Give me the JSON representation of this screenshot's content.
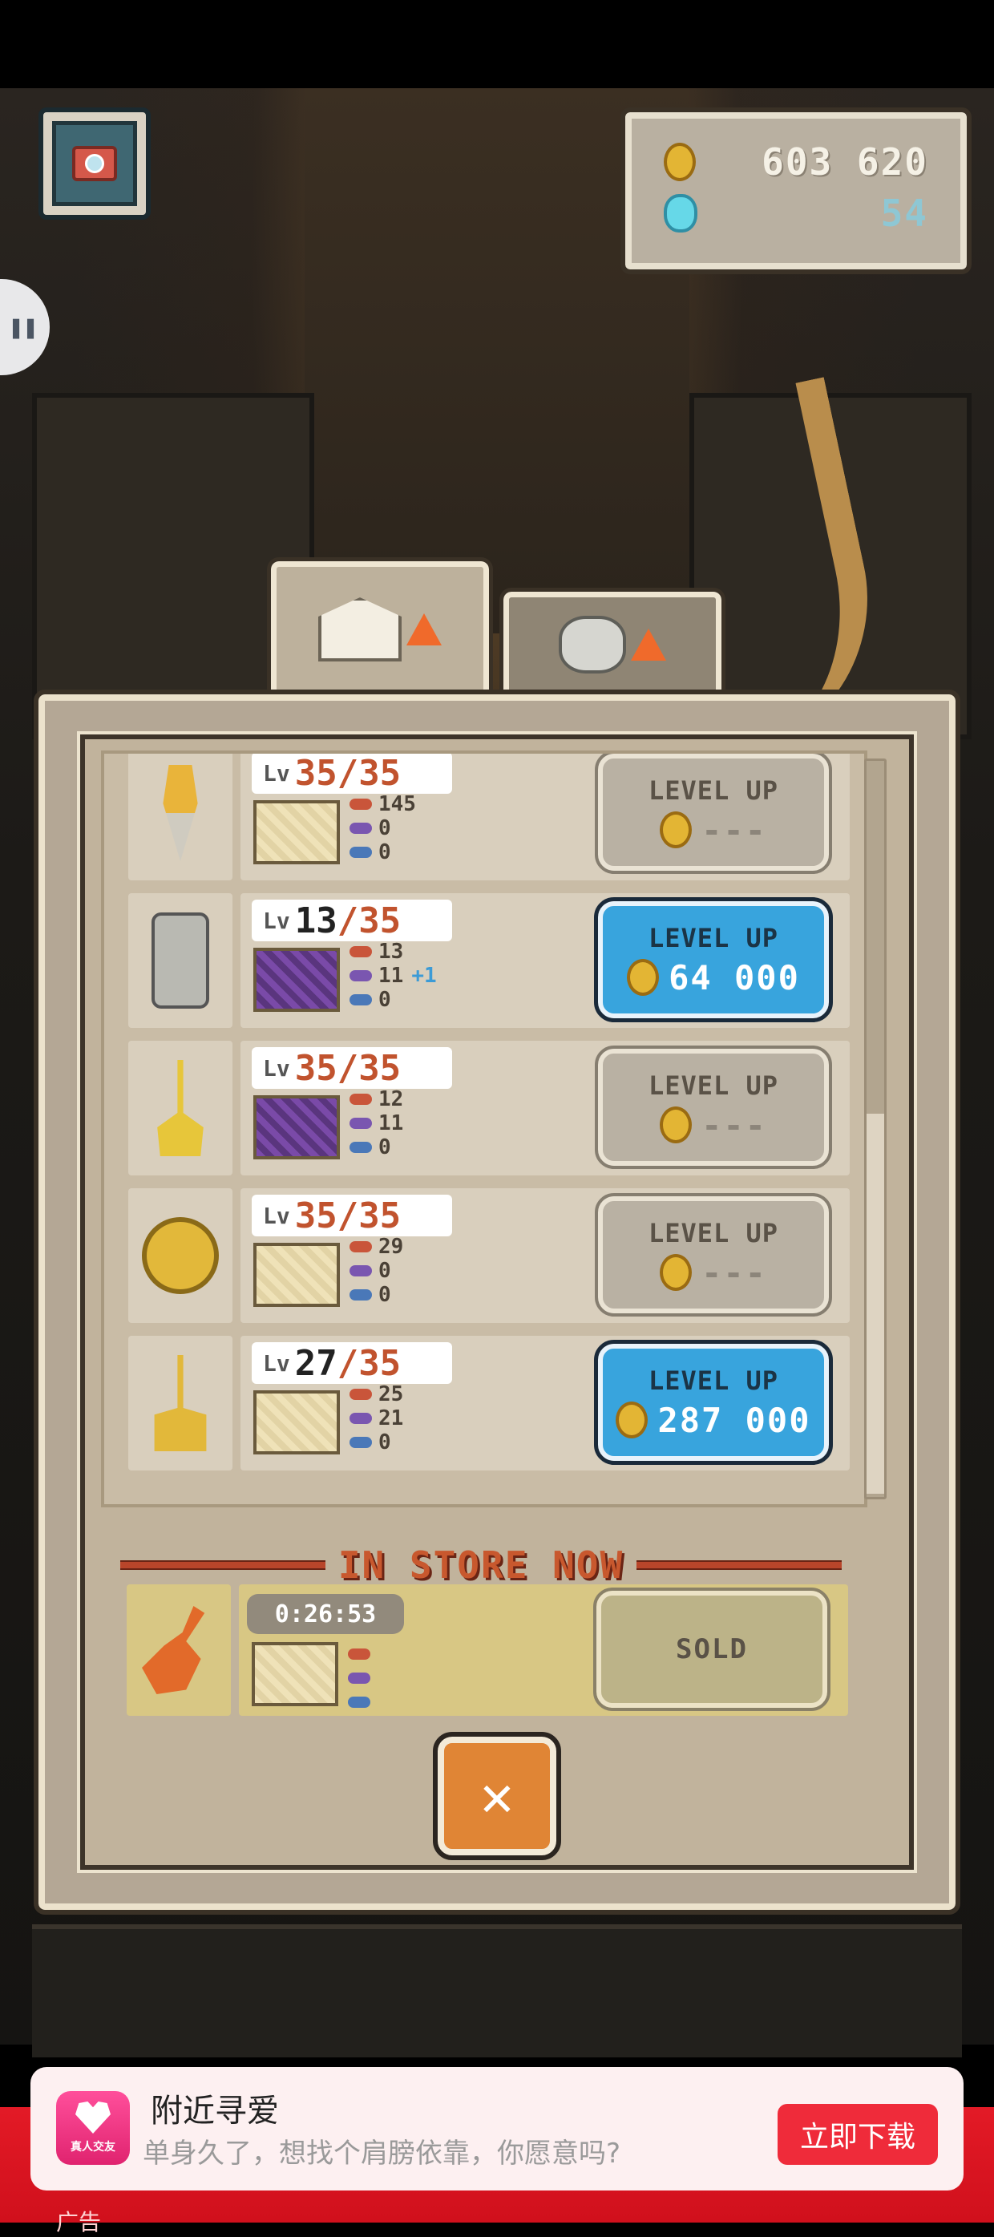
{
  "currency": {
    "gold": "603 620",
    "gems": "54"
  },
  "items": [
    {
      "icon": "drill-icon",
      "level": "35",
      "max": "/35",
      "pattern": "beige",
      "stats": [
        "145",
        "0",
        "0"
      ],
      "bonus": "",
      "button": "LEVEL UP",
      "cost": "---",
      "enabled": false
    },
    {
      "icon": "jackhammer-icon",
      "level": "13",
      "max": "/35",
      "pattern": "purple",
      "stats": [
        "13",
        "11",
        "0"
      ],
      "bonus": "+1",
      "button": "LEVEL UP",
      "cost": "64 000",
      "enabled": true
    },
    {
      "icon": "shovel-icon",
      "level": "35",
      "max": "/35",
      "pattern": "purple",
      "stats": [
        "12",
        "11",
        "0"
      ],
      "bonus": "",
      "button": "LEVEL UP",
      "cost": "---",
      "enabled": false
    },
    {
      "icon": "sun-pickaxe-icon",
      "level": "35",
      "max": "/35",
      "pattern": "beige",
      "stats": [
        "29",
        "0",
        "0"
      ],
      "bonus": "",
      "button": "LEVEL UP",
      "cost": "---",
      "enabled": false
    },
    {
      "icon": "rake-icon",
      "level": "27",
      "max": "/35",
      "pattern": "beige",
      "stats": [
        "25",
        "21",
        "0"
      ],
      "bonus": "",
      "button": "LEVEL UP",
      "cost": "287 000",
      "enabled": true
    }
  ],
  "lv_label": "Lv",
  "store": {
    "title": "IN STORE NOW",
    "timer": "0:26:53",
    "button": "SOLD",
    "icon": "guitar-icon"
  },
  "close_symbol": "✕",
  "ad": {
    "logo_tag": "真人交友",
    "title": "附近寻爱",
    "subtitle": "单身久了，想找个肩膀依靠，你愿意吗?",
    "button": "立即下载",
    "label": "广告"
  }
}
